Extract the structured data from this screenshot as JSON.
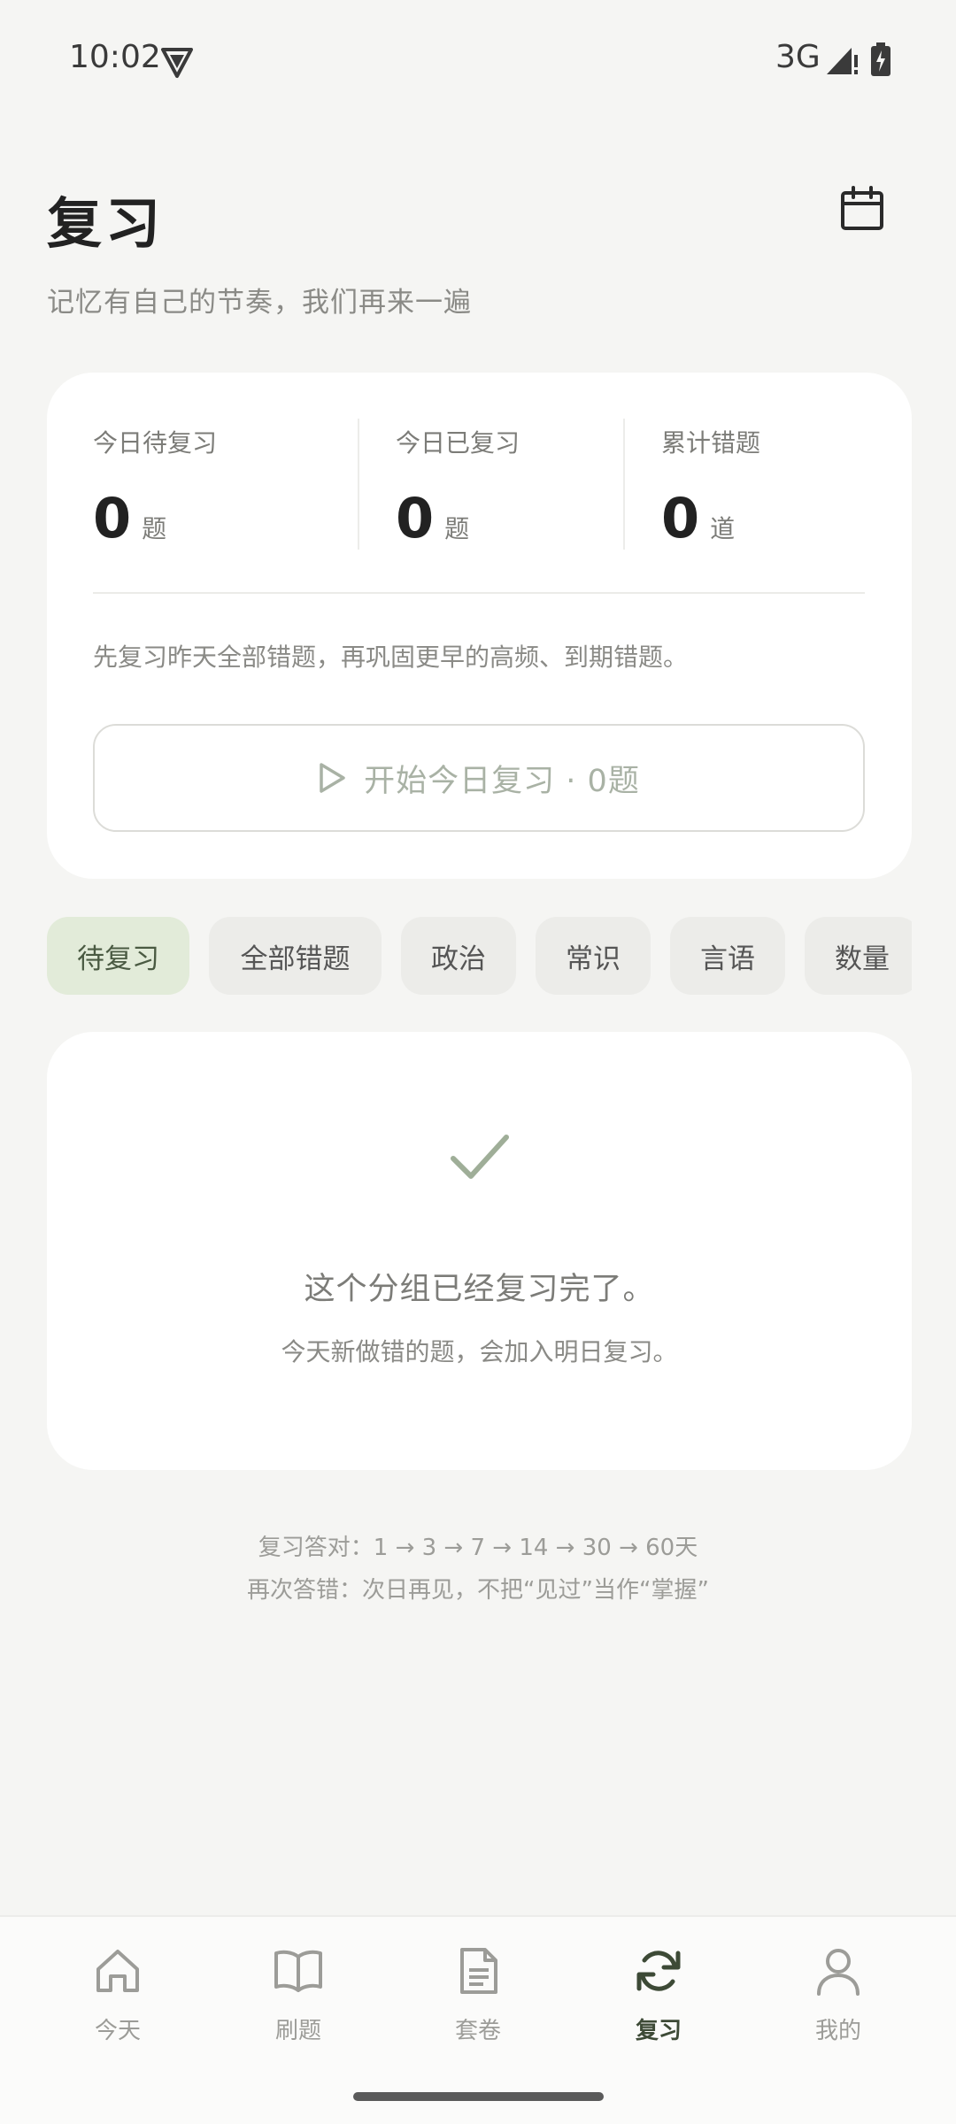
{
  "status_bar": {
    "time": "10:02",
    "network": "3G"
  },
  "header": {
    "title": "复习",
    "subtitle": "记忆有自己的节奏，我们再来一遍"
  },
  "summary": {
    "stats": [
      {
        "label": "今日待复习",
        "value": "0",
        "unit": "题"
      },
      {
        "label": "今日已复习",
        "value": "0",
        "unit": "题"
      },
      {
        "label": "累计错题",
        "value": "0",
        "unit": "道"
      }
    ],
    "tip": "先复习昨天全部错题，再巩固更早的高频、到期错题。",
    "start_button_label": "开始今日复习 · 0题"
  },
  "filters": {
    "chips": [
      "待复习",
      "全部错题",
      "政治",
      "常识",
      "言语",
      "数量"
    ],
    "active_index": 0
  },
  "empty_state": {
    "title": "这个分组已经复习完了。",
    "description": "今天新做错的题，会加入明日复习。"
  },
  "footnotes": {
    "line1": "复习答对：1 → 3 → 7 → 14 → 30 → 60天",
    "line2": "再次答错：次日再见，不把“见过”当作“掌握”"
  },
  "bottom_nav": {
    "items": [
      {
        "label": "今天",
        "icon": "home-icon"
      },
      {
        "label": "刷题",
        "icon": "book-icon"
      },
      {
        "label": "套卷",
        "icon": "document-icon"
      },
      {
        "label": "复习",
        "icon": "refresh-icon"
      },
      {
        "label": "我的",
        "icon": "person-icon"
      }
    ],
    "active_index": 3
  },
  "colors": {
    "background": "#f5f5f3",
    "card": "#ffffff",
    "accent": "#3d4a36",
    "active_chip": "#e2ebd9",
    "muted_text": "#8a8a86"
  }
}
